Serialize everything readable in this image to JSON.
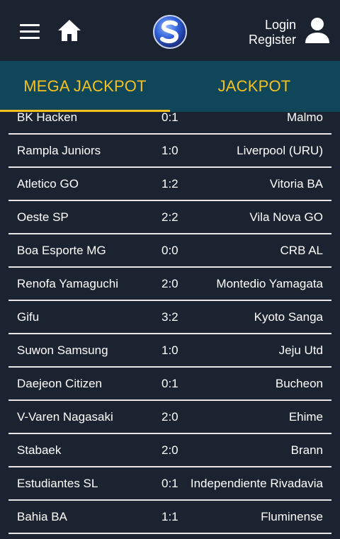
{
  "header": {
    "menu_icon": "hamburger-menu-icon",
    "home_icon": "home-icon",
    "logo_icon": "site-logo-s",
    "login_label": "Login",
    "register_label": "Register",
    "user_icon": "user-account-icon"
  },
  "tabs": [
    {
      "label": "MEGA JACKPOT",
      "active": true
    },
    {
      "label": "JACKPOT",
      "active": false
    }
  ],
  "colors": {
    "background": "#1b2330",
    "tab_bar": "#10465a",
    "accent": "#f4c11f",
    "divider": "#e6e6e6"
  },
  "matches": [
    {
      "home": "BK Hacken",
      "score": "0:1",
      "away": "Malmo"
    },
    {
      "home": "Rampla Juniors",
      "score": "1:0",
      "away": "Liverpool (URU)"
    },
    {
      "home": "Atletico GO",
      "score": "1:2",
      "away": "Vitoria BA"
    },
    {
      "home": "Oeste SP",
      "score": "2:2",
      "away": "Vila Nova GO"
    },
    {
      "home": "Boa Esporte MG",
      "score": "0:0",
      "away": "CRB AL"
    },
    {
      "home": "Renofa Yamaguchi",
      "score": "2:0",
      "away": "Montedio Yamagata"
    },
    {
      "home": "Gifu",
      "score": "3:2",
      "away": "Kyoto Sanga"
    },
    {
      "home": "Suwon Samsung",
      "score": "1:0",
      "away": "Jeju Utd"
    },
    {
      "home": "Daejeon Citizen",
      "score": "0:1",
      "away": "Bucheon"
    },
    {
      "home": "V-Varen Nagasaki",
      "score": "2:0",
      "away": "Ehime"
    },
    {
      "home": "Stabaek",
      "score": "2:0",
      "away": "Brann"
    },
    {
      "home": "Estudiantes SL",
      "score": "0:1",
      "away": "Independiente Rivadavia"
    },
    {
      "home": "Bahia BA",
      "score": "1:1",
      "away": "Fluminense"
    }
  ]
}
